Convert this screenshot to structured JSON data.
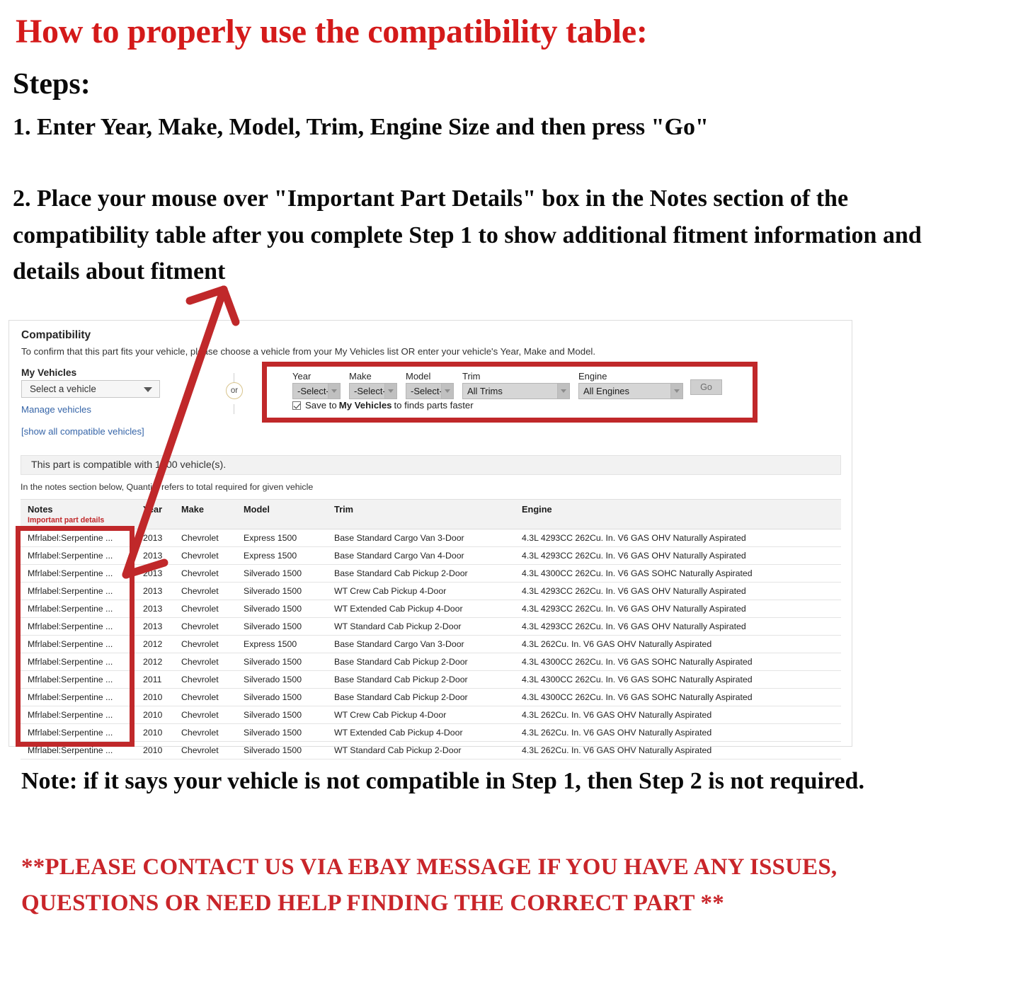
{
  "header": {
    "title": "How to properly use the compatibility table:",
    "steps_label": "Steps:",
    "step1": "1. Enter Year, Make, Model, Trim, Engine Size and then press \"Go\"",
    "step2": "2. Place your mouse over \"Important Part Details\" box in the Notes section of the compatibility table after you complete Step 1 to show additional fitment information and details about fitment"
  },
  "panel": {
    "title": "Compatibility",
    "subtitle": "To confirm that this part fits your vehicle, please choose a vehicle from your My Vehicles list OR enter your vehicle's Year, Make and Model.",
    "my_vehicles_label": "My Vehicles",
    "vehicle_select_value": "Select a vehicle",
    "manage_vehicles_link": "Manage vehicles",
    "show_all_link": "[show all compatible vehicles]",
    "or_label": "or",
    "count_bar": "This part is compatible with 1000 vehicle(s).",
    "notes_hint": "In the notes section below, Quantity refers to total required for given vehicle"
  },
  "form": {
    "fields": [
      {
        "label": "Year",
        "value": "-Select-"
      },
      {
        "label": "Make",
        "value": "-Select-"
      },
      {
        "label": "Model",
        "value": "-Select-"
      },
      {
        "label": "Trim",
        "value": "All Trims"
      },
      {
        "label": "Engine",
        "value": "All Engines"
      }
    ],
    "go_label": "Go",
    "save_prefix": "Save to",
    "save_strong": "My Vehicles",
    "save_suffix": "to finds parts faster",
    "save_checked": true
  },
  "table": {
    "columns": [
      "Notes",
      "Year",
      "Make",
      "Model",
      "Trim",
      "Engine"
    ],
    "notes_sub": "Important part details",
    "rows": [
      {
        "notes": "Mfrlabel:Serpentine ...",
        "year": "2013",
        "make": "Chevrolet",
        "model": "Express 1500",
        "trim": "Base Standard Cargo Van 3-Door",
        "engine": "4.3L 4293CC 262Cu. In. V6 GAS OHV Naturally Aspirated"
      },
      {
        "notes": "Mfrlabel:Serpentine ...",
        "year": "2013",
        "make": "Chevrolet",
        "model": "Express 1500",
        "trim": "Base Standard Cargo Van 4-Door",
        "engine": "4.3L 4293CC 262Cu. In. V6 GAS OHV Naturally Aspirated"
      },
      {
        "notes": "Mfrlabel:Serpentine ...",
        "year": "2013",
        "make": "Chevrolet",
        "model": "Silverado 1500",
        "trim": "Base Standard Cab Pickup 2-Door",
        "engine": "4.3L 4300CC 262Cu. In. V6 GAS SOHC Naturally Aspirated"
      },
      {
        "notes": "Mfrlabel:Serpentine ...",
        "year": "2013",
        "make": "Chevrolet",
        "model": "Silverado 1500",
        "trim": "WT Crew Cab Pickup 4-Door",
        "engine": "4.3L 4293CC 262Cu. In. V6 GAS OHV Naturally Aspirated"
      },
      {
        "notes": "Mfrlabel:Serpentine ...",
        "year": "2013",
        "make": "Chevrolet",
        "model": "Silverado 1500",
        "trim": "WT Extended Cab Pickup 4-Door",
        "engine": "4.3L 4293CC 262Cu. In. V6 GAS OHV Naturally Aspirated"
      },
      {
        "notes": "Mfrlabel:Serpentine ...",
        "year": "2013",
        "make": "Chevrolet",
        "model": "Silverado 1500",
        "trim": "WT Standard Cab Pickup 2-Door",
        "engine": "4.3L 4293CC 262Cu. In. V6 GAS OHV Naturally Aspirated"
      },
      {
        "notes": "Mfrlabel:Serpentine ...",
        "year": "2012",
        "make": "Chevrolet",
        "model": "Express 1500",
        "trim": "Base Standard Cargo Van 3-Door",
        "engine": "4.3L 262Cu. In. V6 GAS OHV Naturally Aspirated"
      },
      {
        "notes": "Mfrlabel:Serpentine ...",
        "year": "2012",
        "make": "Chevrolet",
        "model": "Silverado 1500",
        "trim": "Base Standard Cab Pickup 2-Door",
        "engine": "4.3L 4300CC 262Cu. In. V6 GAS SOHC Naturally Aspirated"
      },
      {
        "notes": "Mfrlabel:Serpentine ...",
        "year": "2011",
        "make": "Chevrolet",
        "model": "Silverado 1500",
        "trim": "Base Standard Cab Pickup 2-Door",
        "engine": "4.3L 4300CC 262Cu. In. V6 GAS SOHC Naturally Aspirated"
      },
      {
        "notes": "Mfrlabel:Serpentine ...",
        "year": "2010",
        "make": "Chevrolet",
        "model": "Silverado 1500",
        "trim": "Base Standard Cab Pickup 2-Door",
        "engine": "4.3L 4300CC 262Cu. In. V6 GAS SOHC Naturally Aspirated"
      },
      {
        "notes": "Mfrlabel:Serpentine ...",
        "year": "2010",
        "make": "Chevrolet",
        "model": "Silverado 1500",
        "trim": "WT Crew Cab Pickup 4-Door",
        "engine": "4.3L 262Cu. In. V6 GAS OHV Naturally Aspirated"
      },
      {
        "notes": "Mfrlabel:Serpentine ...",
        "year": "2010",
        "make": "Chevrolet",
        "model": "Silverado 1500",
        "trim": "WT Extended Cab Pickup 4-Door",
        "engine": "4.3L 262Cu. In. V6 GAS OHV Naturally Aspirated"
      },
      {
        "notes": "Mfrlabel:Serpentine ...",
        "year": "2010",
        "make": "Chevrolet",
        "model": "Silverado 1500",
        "trim": "WT Standard Cab Pickup 2-Door",
        "engine": "4.3L 262Cu. In. V6 GAS OHV Naturally Aspirated"
      }
    ]
  },
  "footer": {
    "note": "Note: if it says your vehicle is not compatible in Step 1, then Step 2 is not required.",
    "contact": "**PLEASE CONTACT US VIA EBAY MESSAGE IF YOU HAVE ANY ISSUES, QUESTIONS OR NEED HELP FINDING THE CORRECT PART **"
  },
  "colors": {
    "headline_red": "#D41A1A",
    "annotation_red": "#C0282A",
    "link_blue": "#3665A8",
    "contact_red": "#C9252A"
  }
}
